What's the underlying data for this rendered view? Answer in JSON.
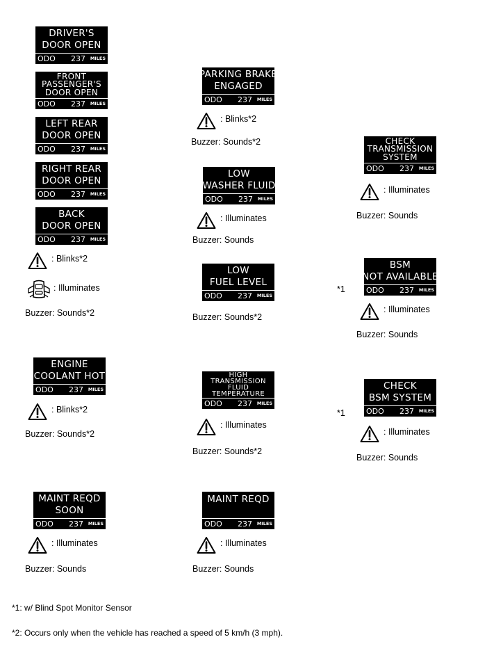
{
  "odo_label": "ODO",
  "odo_value": "237",
  "odo_unit": "MILES",
  "sensor_marker": "*1",
  "displays": {
    "drivers_door": [
      "DRIVER'S",
      "DOOR  OPEN"
    ],
    "front_passenger_door": [
      "FRONT",
      "PASSENGER'S",
      "DOOR  OPEN"
    ],
    "left_rear_door": [
      "LEFT REAR",
      "DOOR  OPEN"
    ],
    "right_rear_door": [
      "RIGHT REAR",
      "DOOR  OPEN"
    ],
    "back_door": [
      "BACK",
      "DOOR  OPEN"
    ],
    "parking_brake": [
      "PARKING BRAKE",
      "ENGAGED"
    ],
    "low_washer_fluid": [
      "LOW",
      "WASHER FLUID"
    ],
    "low_fuel_level": [
      "LOW",
      "FUEL   LEVEL"
    ],
    "check_transmission": [
      "CHECK",
      "TRANSMISSION",
      "SYSTEM"
    ],
    "bsm_not_available": [
      "BSM",
      "NOT AVAILABLE"
    ],
    "check_bsm": [
      "CHECK",
      "BSM SYSTEM"
    ],
    "engine_coolant_hot": [
      "ENGINE",
      "COOLANT HOT"
    ],
    "high_trans_fluid_temp": [
      "HIGH",
      "TRANSMISSION",
      "FLUID",
      "TEMPERATURE"
    ],
    "maint_reqd_soon": [
      "MAINT REQD",
      "SOON"
    ],
    "maint_reqd": [
      "MAINT REQD"
    ]
  },
  "labels": {
    "blinks": ": Blinks*2",
    "illuminates": ": Illuminates",
    "buzzer_sounds": "Buzzer: Sounds",
    "buzzer_sounds_2": "Buzzer: Sounds*2"
  },
  "footnotes": {
    "note1": "*1: w/ Blind Spot Monitor Sensor",
    "note2": "*2: Occurs only when the vehicle has reached a speed of 5 km/h (3 mph)."
  },
  "icons": {
    "warning": "warning-triangle-icon",
    "door": "door-open-car-icon"
  }
}
